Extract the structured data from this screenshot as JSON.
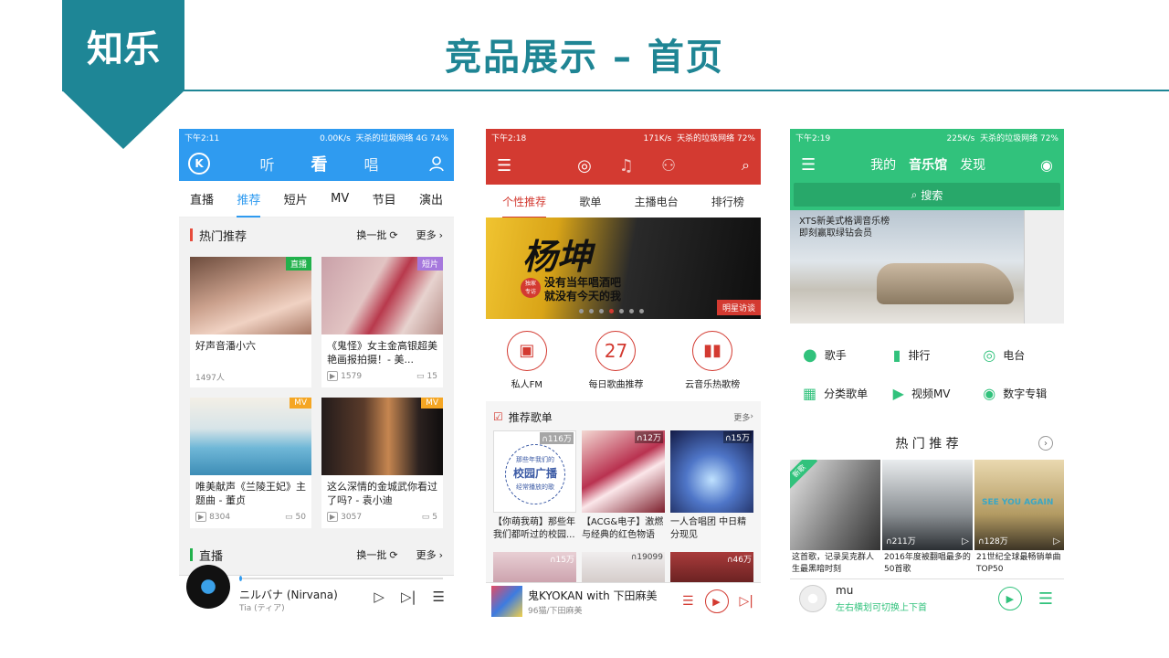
{
  "header": {
    "logo": "知乐",
    "title": "竞品展示 – 首页"
  },
  "p1": {
    "status": {
      "time": "下午2:11",
      "speed": "0.00K/s",
      "network": "天杀的垃圾网络 4G",
      "battery": "74%"
    },
    "top_tabs": [
      "听",
      "看",
      "唱"
    ],
    "sub_tabs": [
      "直播",
      "推荐",
      "短片",
      "MV",
      "节目",
      "演出"
    ],
    "hot": {
      "title": "热门推荐",
      "refresh": "换一批",
      "more": "更多"
    },
    "cards": [
      {
        "title": "好声音潘小六",
        "meta": "1497人",
        "comments": "",
        "badge": "直播",
        "badge_color": "#22b14c"
      },
      {
        "title": "《鬼怪》女主金高银超美艳画报拍摄！- 美...",
        "meta": "1579",
        "comments": "15",
        "badge": "短片",
        "badge_color": "#a678dd"
      },
      {
        "title": "唯美献声《兰陵王妃》主题曲 - 董贞",
        "meta": "8304",
        "comments": "50",
        "badge": "MV",
        "badge_color": "#f5a623"
      },
      {
        "title": "这么深情的金城武你看过了吗? - 袁小迪",
        "meta": "3057",
        "comments": "5",
        "badge": "MV",
        "badge_color": "#f5a623"
      }
    ],
    "live": {
      "title": "直播",
      "refresh": "换一批",
      "more": "更多"
    },
    "player": {
      "song": "ニルバナ (Nirvana)",
      "artist": "Tia (ティア)"
    }
  },
  "p2": {
    "status": {
      "time": "下午2:18",
      "speed": "171K/s",
      "network": "天杀的垃圾网络",
      "battery": "72%"
    },
    "tabs": [
      "个性推荐",
      "歌单",
      "主播电台",
      "排行榜"
    ],
    "banner": {
      "name": "杨坤",
      "badge_top": "独家",
      "badge_bottom": "专访",
      "line1": "没有当年唱酒吧",
      "line2": "就没有今天的我",
      "tag": "明星访谈"
    },
    "shortcuts": [
      {
        "label": "私人FM"
      },
      {
        "label": "每日歌曲推荐",
        "num": "27"
      },
      {
        "label": "云音乐热歌榜"
      }
    ],
    "rec": {
      "title": "推荐歌单",
      "more": "更多"
    },
    "playlists": [
      {
        "title": "【你萌我萌】那些年我们都听过的校园...",
        "count": "116万",
        "inner_top": "那些年我们的",
        "inner_main": "校园广播",
        "inner_bottom": "经常播放的歌"
      },
      {
        "title": "【ACG&电子】激燃与经典的红色物语",
        "count": "12万"
      },
      {
        "title": "一人合唱团 中日精分现见",
        "count": "15万"
      }
    ],
    "second_counts": [
      "15万",
      "19099",
      "46万"
    ],
    "player": {
      "song": "鬼KYOKAN with 下田麻美",
      "artist": "96猫/下田麻美"
    }
  },
  "p3": {
    "status": {
      "time": "下午2:19",
      "speed": "225K/s",
      "network": "天杀的垃圾网络",
      "battery": "72%"
    },
    "nav": [
      "我的",
      "音乐馆",
      "发现"
    ],
    "search": "搜索",
    "banner": {
      "line1": "XTS新美式格调音乐榜",
      "line2": "即刻赢取绿钻会员"
    },
    "grid": [
      "歌手",
      "排行",
      "电台",
      "分类歌单",
      "视频MV",
      "数字专辑"
    ],
    "hot": {
      "title": "热 门 推 荐"
    },
    "items": [
      {
        "title": "这首歌，记录吴克群人生最黑暗时刻",
        "count": "",
        "tag": "新歌"
      },
      {
        "title": "2016年度被翻唱最多的50首歌",
        "count": "211万"
      },
      {
        "title": "21世纪全球最畅销单曲TOP50",
        "count": "128万",
        "overlay": "SEE YOU AGAIN"
      }
    ],
    "player": {
      "song": "mu",
      "hint": "左右横划可切换上下首"
    }
  }
}
